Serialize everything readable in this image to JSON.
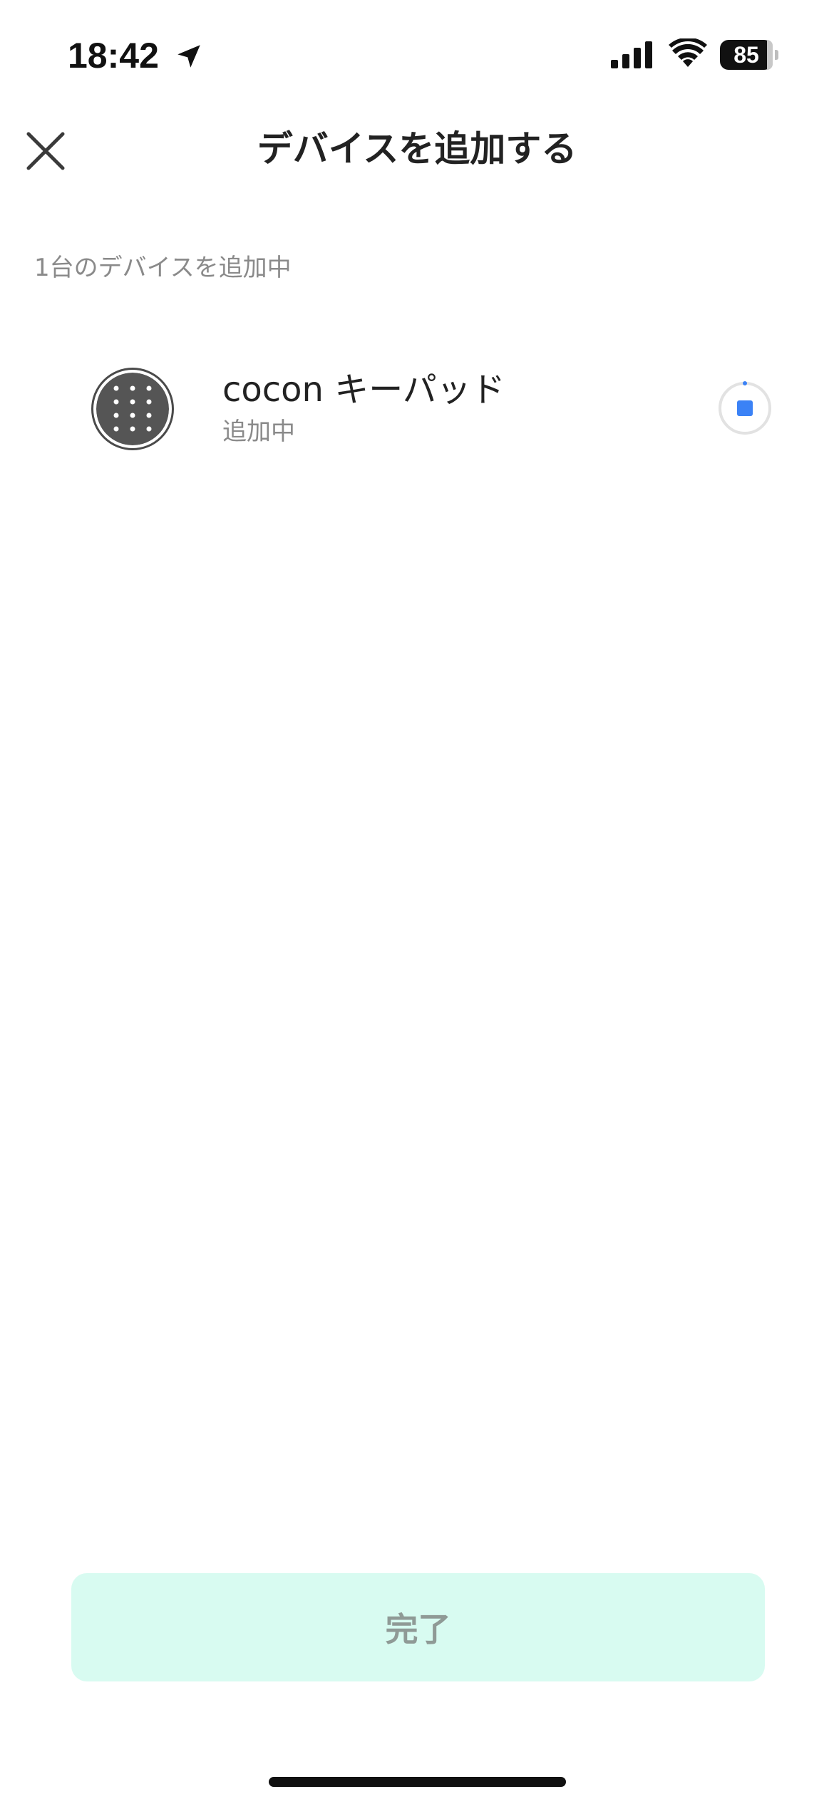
{
  "status_bar": {
    "time": "18:42",
    "battery_level": "85",
    "icons": [
      "location-arrow-icon",
      "cellular-signal-icon",
      "wifi-icon",
      "battery-icon"
    ]
  },
  "header": {
    "title": "デバイスを追加する",
    "close_icon": "close-icon"
  },
  "section": {
    "label": "1台のデバイスを追加中"
  },
  "device": {
    "name": "cocon キーパッド",
    "status": "追加中",
    "icon": "keypad-icon",
    "action_icon": "stop-progress-icon"
  },
  "footer": {
    "done_label": "完了"
  },
  "colors": {
    "accent_blue": "#3b82f6",
    "done_button_bg": "#d8fbf1",
    "done_button_text": "#8f9a96",
    "secondary_text": "#8a8a8a"
  }
}
